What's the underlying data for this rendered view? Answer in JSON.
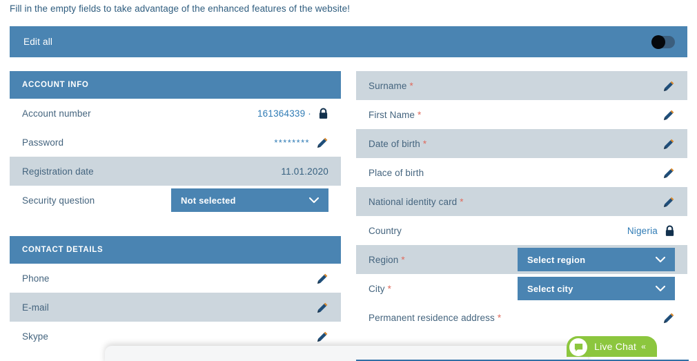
{
  "intro": {
    "text": "Fill in the empty fields to take advantage of the enhanced features of the website!"
  },
  "edit_all_bar": {
    "label": "Edit all",
    "toggle_state": "off",
    "toggle_name": "edit-all-toggle",
    "bar_color": "#4a84b2"
  },
  "colors": {
    "header_blue": "#4a84b2",
    "row_alt": "#ccd6dd",
    "label_text": "#44647e",
    "value_blue": "#2f7bb5",
    "required_star": "#e06a5c",
    "live_chat_green": "#8cc63e"
  },
  "left_column": {
    "panels": [
      {
        "title": "ACCOUNT INFO",
        "rows": [
          {
            "label": "Account number",
            "required": false,
            "alt": false,
            "value": "161364339 ·",
            "value_style": "link",
            "control": "lock"
          },
          {
            "label": "Password",
            "required": false,
            "alt": false,
            "value": "********",
            "value_style": "stars",
            "control": "pencil"
          },
          {
            "label": "Registration date",
            "required": false,
            "alt": true,
            "value": "11.01.2020",
            "value_style": "plain",
            "control": "none"
          },
          {
            "label": "Security question",
            "required": false,
            "alt": false,
            "value": "",
            "value_style": "none",
            "control": "select",
            "select_label": "Not selected"
          }
        ]
      },
      {
        "title": "CONTACT DETAILS",
        "rows": [
          {
            "label": "Phone",
            "required": false,
            "alt": false,
            "value": "",
            "value_style": "none",
            "control": "pencil"
          },
          {
            "label": "E-mail",
            "required": false,
            "alt": true,
            "value": "",
            "value_style": "none",
            "control": "pencil"
          },
          {
            "label": "Skype",
            "required": false,
            "alt": false,
            "value": "",
            "value_style": "none",
            "control": "pencil"
          }
        ]
      }
    ]
  },
  "right_column": {
    "rows": [
      {
        "label": "Surname",
        "required": true,
        "alt": true,
        "value": "",
        "value_style": "none",
        "control": "pencil"
      },
      {
        "label": "First Name",
        "required": true,
        "alt": false,
        "value": "",
        "value_style": "none",
        "control": "pencil"
      },
      {
        "label": "Date of birth",
        "required": true,
        "alt": true,
        "value": "",
        "value_style": "none",
        "control": "pencil"
      },
      {
        "label": "Place of birth",
        "required": false,
        "alt": false,
        "value": "",
        "value_style": "none",
        "control": "pencil"
      },
      {
        "label": "National identity card",
        "required": true,
        "alt": true,
        "value": "",
        "value_style": "none",
        "control": "pencil"
      },
      {
        "label": "Country",
        "required": false,
        "alt": false,
        "value": "Nigeria",
        "value_style": "link",
        "control": "lock"
      },
      {
        "label": "Region",
        "required": true,
        "alt": true,
        "value": "",
        "value_style": "none",
        "control": "select",
        "select_label": "Select region"
      },
      {
        "label": "City",
        "required": true,
        "alt": false,
        "value": "",
        "value_style": "none",
        "control": "select",
        "select_label": "Select city"
      },
      {
        "label": "Permanent residence address",
        "required": true,
        "alt": false,
        "value": "",
        "value_style": "none",
        "control": "pencil"
      }
    ]
  },
  "live_chat": {
    "label": "Live Chat",
    "chevron": "«"
  }
}
